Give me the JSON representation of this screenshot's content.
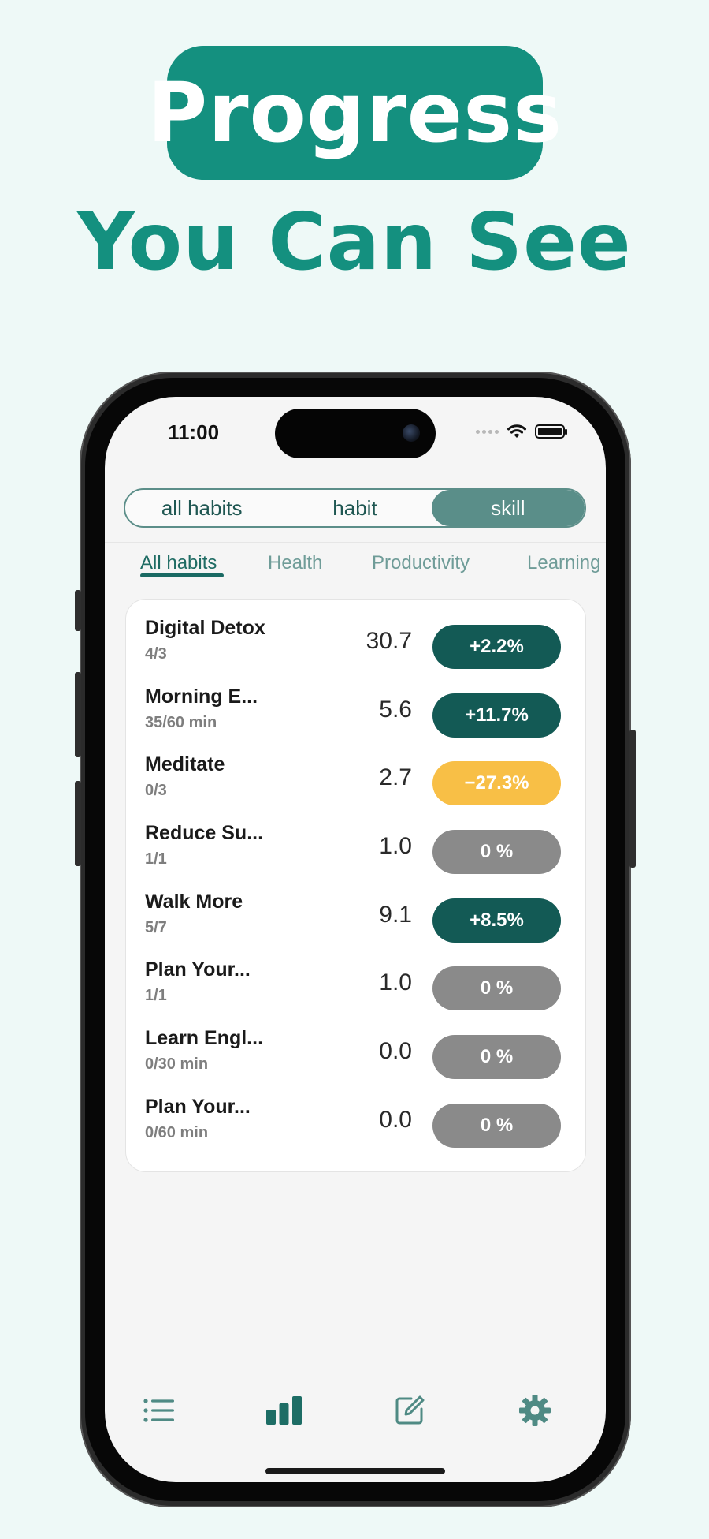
{
  "hero": {
    "title": "Progress",
    "subtitle": "You Can See"
  },
  "status_bar": {
    "time": "11:00"
  },
  "segment": {
    "items": [
      "all habits",
      "habit",
      "skill"
    ],
    "selected": "skill"
  },
  "tabs": {
    "items": [
      "All habits",
      "Health",
      "Productivity",
      "Learning"
    ],
    "selected": "All habits"
  },
  "habits": [
    {
      "name": "Digital Detox",
      "progress": "4/3",
      "value": "30.7",
      "change": "+2.2%",
      "status": "up"
    },
    {
      "name": "Morning E...",
      "progress": "35/60 min",
      "value": "5.6",
      "change": "+11.7%",
      "status": "up"
    },
    {
      "name": "Meditate",
      "progress": "0/3",
      "value": "2.7",
      "change": "−27.3%",
      "status": "down"
    },
    {
      "name": "Reduce Su...",
      "progress": "1/1",
      "value": "1.0",
      "change": "0 %",
      "status": "flat"
    },
    {
      "name": "Walk More",
      "progress": "5/7",
      "value": "9.1",
      "change": "+8.5%",
      "status": "up"
    },
    {
      "name": "Plan Your...",
      "progress": "1/1",
      "value": "1.0",
      "change": "0 %",
      "status": "flat"
    },
    {
      "name": "Learn Engl...",
      "progress": "0/30 min",
      "value": "0.0",
      "change": "0 %",
      "status": "flat"
    },
    {
      "name": "Plan Your...",
      "progress": "0/60 min",
      "value": "0.0",
      "change": "0 %",
      "status": "flat"
    }
  ],
  "colors": {
    "brand": "#14907f",
    "up": "#135a55",
    "down": "#f8bf46",
    "flat": "#8a8a8a"
  },
  "bottom_nav": {
    "items": [
      {
        "icon": "list-icon",
        "selected": false
      },
      {
        "icon": "bar-chart-icon",
        "selected": true
      },
      {
        "icon": "edit-icon",
        "selected": false
      },
      {
        "icon": "gear-icon",
        "selected": false
      }
    ]
  }
}
